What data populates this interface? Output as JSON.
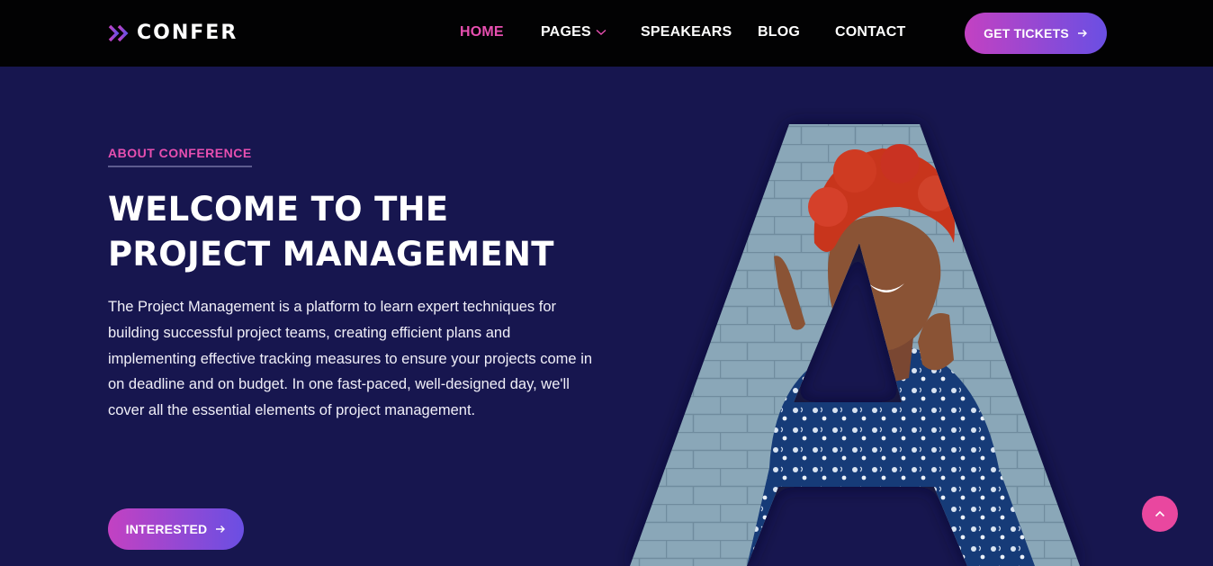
{
  "brand": {
    "name": "CONFER",
    "logo_icon": "double-chevron-icon"
  },
  "nav": {
    "items": [
      {
        "label": "HOME",
        "active": true
      },
      {
        "label": "PAGES",
        "has_dropdown": true
      },
      {
        "label": "SPEAKEARS"
      },
      {
        "label": "BLOG"
      },
      {
        "label": "CONTACT"
      }
    ],
    "cta_label": "GET TICKETS"
  },
  "hero": {
    "eyebrow": "ABOUT CONFERENCE",
    "title_line1": "WELCOME TO THE",
    "title_line2": "PROJECT MANAGEMENT",
    "body": "The Project Management is a platform to learn expert techniques for building successful project teams, creating efficient plans and implementing effective tracking measures to ensure your projects come in on deadline and on budget. In one fast-paced, well-designed day, we'll cover all the essential elements of project management.",
    "cta_label": "INTERESTED"
  },
  "colors": {
    "background": "#17164f",
    "navbar": "#020203",
    "accent_pink": "#e74fb0",
    "gradient_start": "#c341c2",
    "gradient_end": "#6a4fe3",
    "scroll_top": "#e9479f"
  },
  "icons": {
    "arrow": "arrow-right-icon",
    "scroll": "chevron-up-icon",
    "dropdown": "chevron-down-icon"
  }
}
